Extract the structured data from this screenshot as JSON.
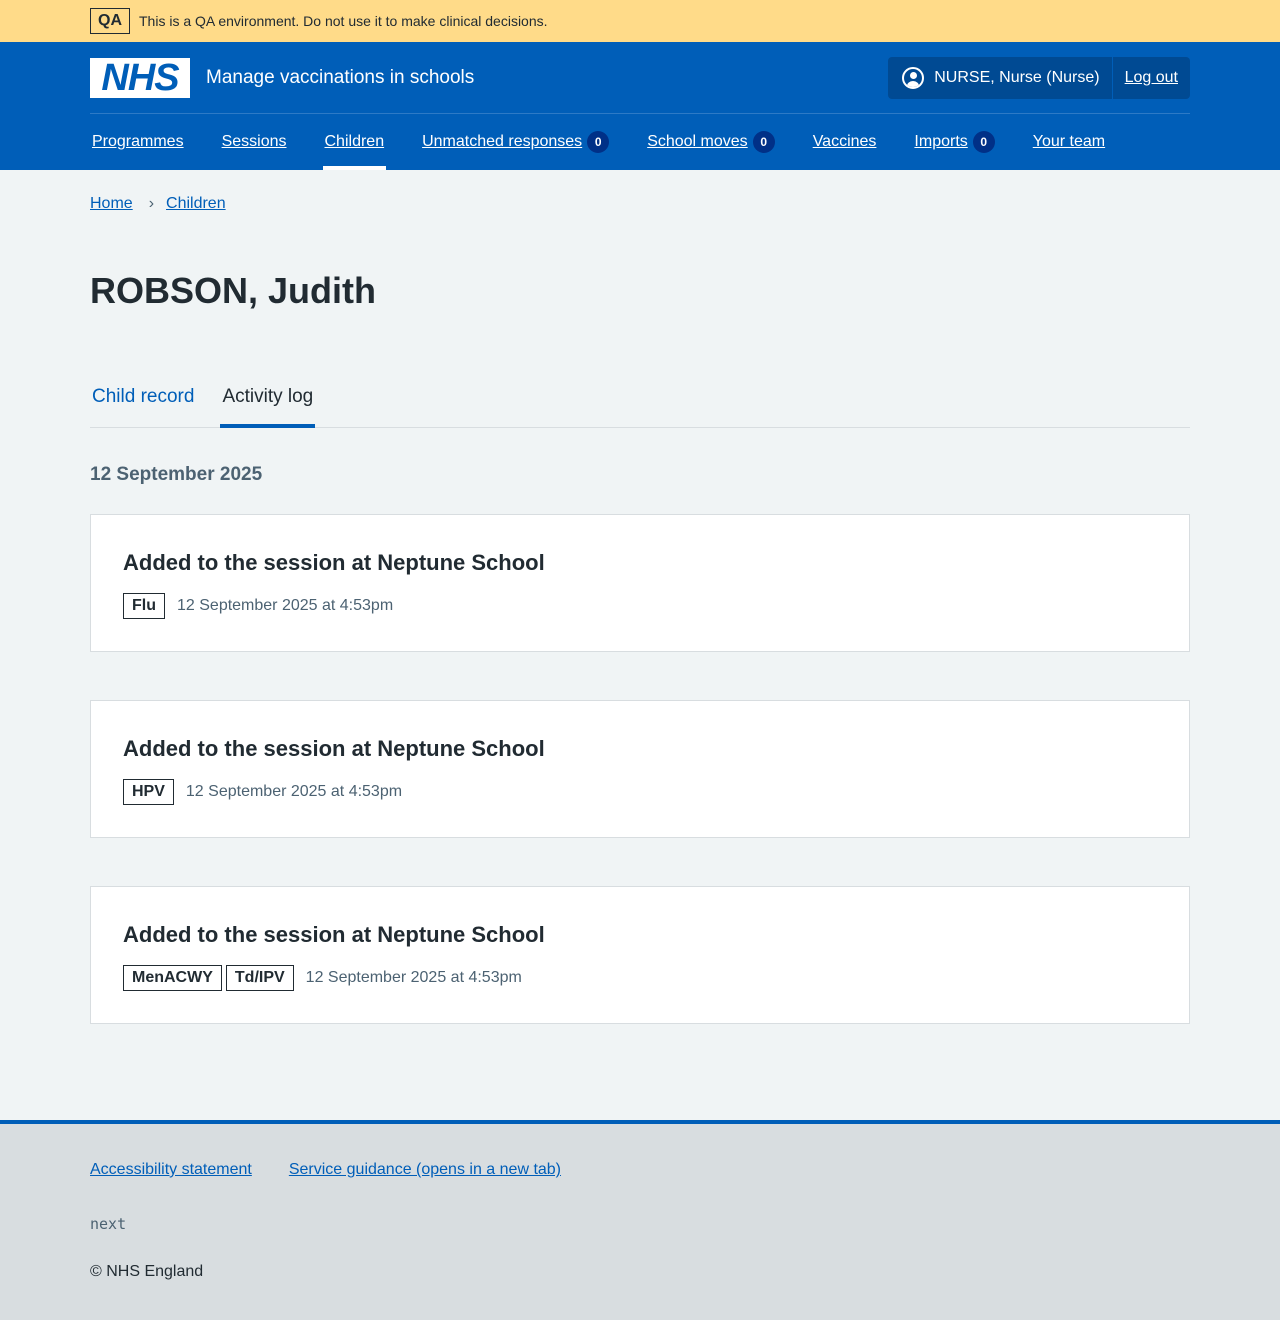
{
  "qa_banner": {
    "tag": "QA",
    "text": "This is a QA environment. Do not use it to make clinical decisions."
  },
  "header": {
    "logo": "NHS",
    "service_name": "Manage vaccinations in schools",
    "user": "NURSE, Nurse (Nurse)",
    "logout": "Log out"
  },
  "nav": {
    "items": [
      {
        "label": "Programmes"
      },
      {
        "label": "Sessions"
      },
      {
        "label": "Children",
        "active": true
      },
      {
        "label": "Unmatched responses",
        "count": "0"
      },
      {
        "label": "School moves",
        "count": "0"
      },
      {
        "label": "Vaccines"
      },
      {
        "label": "Imports",
        "count": "0"
      },
      {
        "label": "Your team"
      }
    ]
  },
  "breadcrumb": [
    "Home",
    "Children"
  ],
  "page_title": "ROBSON, Judith",
  "tabs": [
    {
      "label": "Child record",
      "current": false
    },
    {
      "label": "Activity log",
      "current": true
    }
  ],
  "activity": {
    "date_heading": "12 September 2025",
    "events": [
      {
        "title": "Added to the session at Neptune School",
        "tags": [
          "Flu"
        ],
        "time": "12 September 2025 at 4:53pm"
      },
      {
        "title": "Added to the session at Neptune School",
        "tags": [
          "HPV"
        ],
        "time": "12 September 2025 at 4:53pm"
      },
      {
        "title": "Added to the session at Neptune School",
        "tags": [
          "MenACWY",
          "Td/IPV"
        ],
        "time": "12 September 2025 at 4:53pm"
      }
    ]
  },
  "footer": {
    "links": [
      "Accessibility statement",
      "Service guidance (opens in a new tab)"
    ],
    "version": "next",
    "copyright": "© NHS England"
  },
  "colors": {
    "brand_blue": "#005eb8",
    "qa_yellow": "#ffdb89",
    "page_bg": "#f0f4f5",
    "footer_bg": "#d8dde0"
  }
}
